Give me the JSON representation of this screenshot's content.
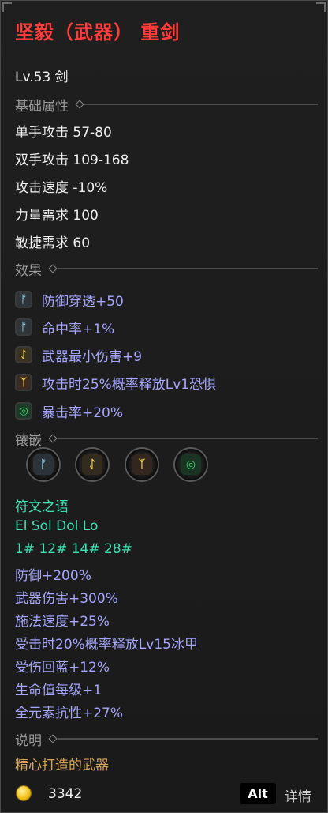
{
  "title": "坚毅（武器） 重剑",
  "level_line": "Lv.53 剑",
  "base_attributes": {
    "header": "基础属性",
    "lines": [
      "单手攻击 57-80",
      "双手攻击 109-168",
      "攻击速度 -10%",
      "力量需求 100",
      "敏捷需求 60"
    ]
  },
  "effects": {
    "header": "效果",
    "items": [
      {
        "icon": "rune-el-icon",
        "glyph": "ᚠ",
        "color": "#7fb8c9",
        "bg": "#2e3438",
        "text": "防御穿透+50"
      },
      {
        "icon": "rune-el-icon",
        "glyph": "ᚠ",
        "color": "#7fb8c9",
        "bg": "#2e3438",
        "text": "命中率+1%"
      },
      {
        "icon": "rune-sol-icon",
        "glyph": "ᛇ",
        "color": "#f3d44a",
        "bg": "#3a3322",
        "text": "武器最小伤害+9"
      },
      {
        "icon": "rune-dol-icon",
        "glyph": "ᛉ",
        "color": "#f3d44a",
        "bg": "#3a2a22",
        "text": "攻击时25%概率释放Lv1恐惧"
      },
      {
        "icon": "rune-lo-icon",
        "glyph": "◎",
        "color": "#3ed46a",
        "bg": "#1d3a26",
        "text": "暴击率+20%"
      }
    ]
  },
  "sockets": {
    "header": "镶嵌",
    "items": [
      {
        "icon": "socket-rune-el-icon",
        "glyph": "ᚠ",
        "color": "#7fb8c9",
        "bg": "#2b3338"
      },
      {
        "icon": "socket-rune-sol-icon",
        "glyph": "ᛇ",
        "color": "#f3d44a",
        "bg": "#332c1e"
      },
      {
        "icon": "socket-rune-dol-icon",
        "glyph": "ᛉ",
        "color": "#f3d44a",
        "bg": "#33261e"
      },
      {
        "icon": "socket-rune-lo-icon",
        "glyph": "◎",
        "color": "#3ed46a",
        "bg": "#1a3524"
      }
    ]
  },
  "runeword": {
    "label": "符文之语",
    "runes": "El Sol Dol Lo",
    "numbers": "1# 12# 14# 28#",
    "bonuses": [
      "防御+200%",
      "武器伤害+300%",
      "施法速度+25%",
      "受击时20%概率释放Lv15冰甲",
      "受伤回蓝+12%",
      "生命值每级+1",
      "全元素抗性+27%"
    ]
  },
  "description": {
    "header": "说明",
    "text": "精心打造的武器"
  },
  "footer": {
    "gold": "3342",
    "alt_key": "Alt",
    "detail_label": "详情"
  },
  "colors": {
    "title": "#ff3b3b",
    "affix": "#a7a7ff",
    "runeword": "#3fe3b4",
    "flavor": "#d8a65a"
  }
}
